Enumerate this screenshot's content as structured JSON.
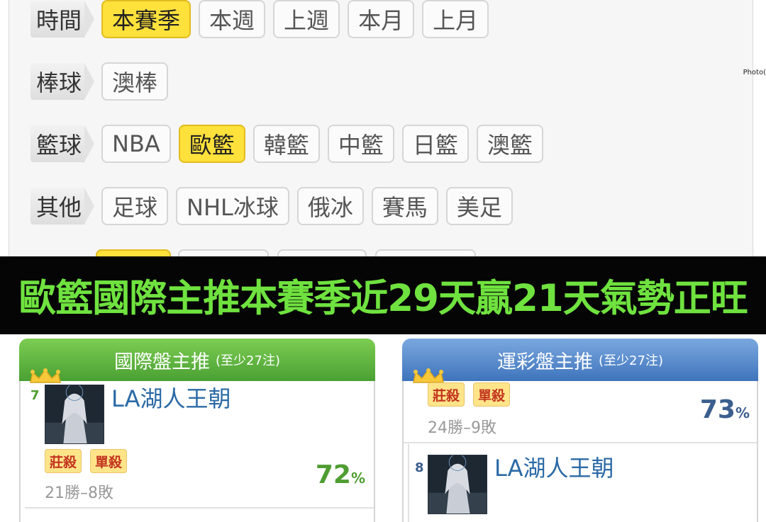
{
  "filters": {
    "rows": [
      {
        "label": "時間",
        "chips": [
          {
            "text": "本賽季",
            "active": true
          },
          {
            "text": "本週",
            "active": false
          },
          {
            "text": "上週",
            "active": false
          },
          {
            "text": "本月",
            "active": false
          },
          {
            "text": "上月",
            "active": false
          }
        ]
      },
      {
        "label": "棒球",
        "chips": [
          {
            "text": "澳棒",
            "active": false
          }
        ]
      },
      {
        "label": "籃球",
        "chips": [
          {
            "text": "NBA",
            "active": false
          },
          {
            "text": "歐籃",
            "active": true
          },
          {
            "text": "韓籃",
            "active": false
          },
          {
            "text": "中籃",
            "active": false
          },
          {
            "text": "日籃",
            "active": false
          },
          {
            "text": "澳籃",
            "active": false
          }
        ]
      },
      {
        "label": "其他",
        "chips": [
          {
            "text": "足球",
            "active": false
          },
          {
            "text": "NHL冰球",
            "active": false
          },
          {
            "text": "俄冰",
            "active": false
          },
          {
            "text": "賽馬",
            "active": false
          },
          {
            "text": "美足",
            "active": false
          }
        ]
      }
    ],
    "photo_tag": "Photo("
  },
  "banner": {
    "text": "歐籃國際主推本賽季近29天贏21天氣勢正旺"
  },
  "cards": {
    "left": {
      "title": "國際盤主推",
      "subtitle": "(至少27注)",
      "entry": {
        "rank": "7",
        "name": "LA湖人王朝",
        "tags": [
          "莊殺",
          "單殺"
        ],
        "record": "21勝–8敗",
        "percent": "72",
        "percent_unit": "%"
      }
    },
    "right": {
      "title": "運彩盤主推",
      "subtitle": "(至少27注)",
      "prev_entry": {
        "tags": [
          "莊殺",
          "單殺"
        ],
        "record": "24勝–9敗",
        "percent": "73",
        "percent_unit": "%"
      },
      "entry": {
        "rank": "8",
        "name": "LA湖人王朝"
      }
    }
  },
  "colors": {
    "active_chip": "#ffe13b",
    "banner_text": "#6fe23f",
    "left_header": "#4aa033",
    "right_header": "#3f74bc",
    "name_blue": "#2b6aa6",
    "tag_red": "#c2331d",
    "pct_green": "#4f9d32",
    "pct_blue": "#3c5f8f"
  }
}
